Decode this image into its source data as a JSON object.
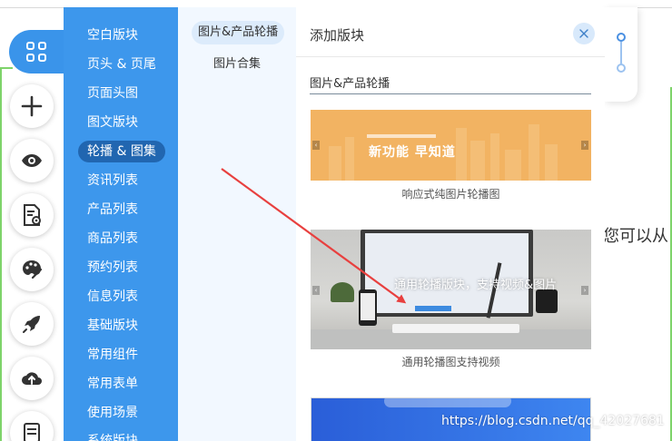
{
  "rail": {
    "items": [
      {
        "name": "blocks",
        "icon": "grid-icon"
      },
      {
        "name": "add",
        "icon": "plus-icon"
      },
      {
        "name": "preview",
        "icon": "eye-icon"
      },
      {
        "name": "page-settings",
        "icon": "document-gear-icon"
      },
      {
        "name": "theme",
        "icon": "palette-icon"
      },
      {
        "name": "publish",
        "icon": "rocket-icon"
      },
      {
        "name": "upload",
        "icon": "cloud-upload-icon"
      },
      {
        "name": "settings",
        "icon": "sliders-icon"
      }
    ]
  },
  "categories": {
    "items": [
      {
        "label": "空白版块"
      },
      {
        "label": "页头 & 页尾"
      },
      {
        "label": "页面头图"
      },
      {
        "label": "图文版块"
      },
      {
        "label": "轮播 & 图集",
        "active": true
      },
      {
        "label": "资讯列表"
      },
      {
        "label": "产品列表"
      },
      {
        "label": "商品列表"
      },
      {
        "label": "预约列表"
      },
      {
        "label": "信息列表"
      },
      {
        "label": "基础版块"
      },
      {
        "label": "常用组件"
      },
      {
        "label": "常用表单"
      },
      {
        "label": "使用场景"
      },
      {
        "label": "系统版块"
      }
    ]
  },
  "subcategories": {
    "items": [
      {
        "label": "图片&产品轮播",
        "active": true
      },
      {
        "label": "图片合集"
      }
    ]
  },
  "panel": {
    "title": "添加版块",
    "section_title": "图片&产品轮播",
    "blocks": [
      {
        "caption": "响应式纯图片轮播图",
        "thumbnail_text": "新功能 早知道"
      },
      {
        "caption": "通用轮播图支持视频",
        "thumbnail_text": "通用轮播版块，支持视频&图片"
      },
      {
        "caption": ""
      }
    ]
  },
  "background": {
    "text": "您可以从"
  },
  "watermark": "https://blog.csdn.net/qq_42027681",
  "colors": {
    "primary": "#3d97ec",
    "active_category": "#2166b0",
    "submenu_bg": "#f2f8ff",
    "arrow": "#e8403f",
    "guide_green": "#7ed36a"
  }
}
